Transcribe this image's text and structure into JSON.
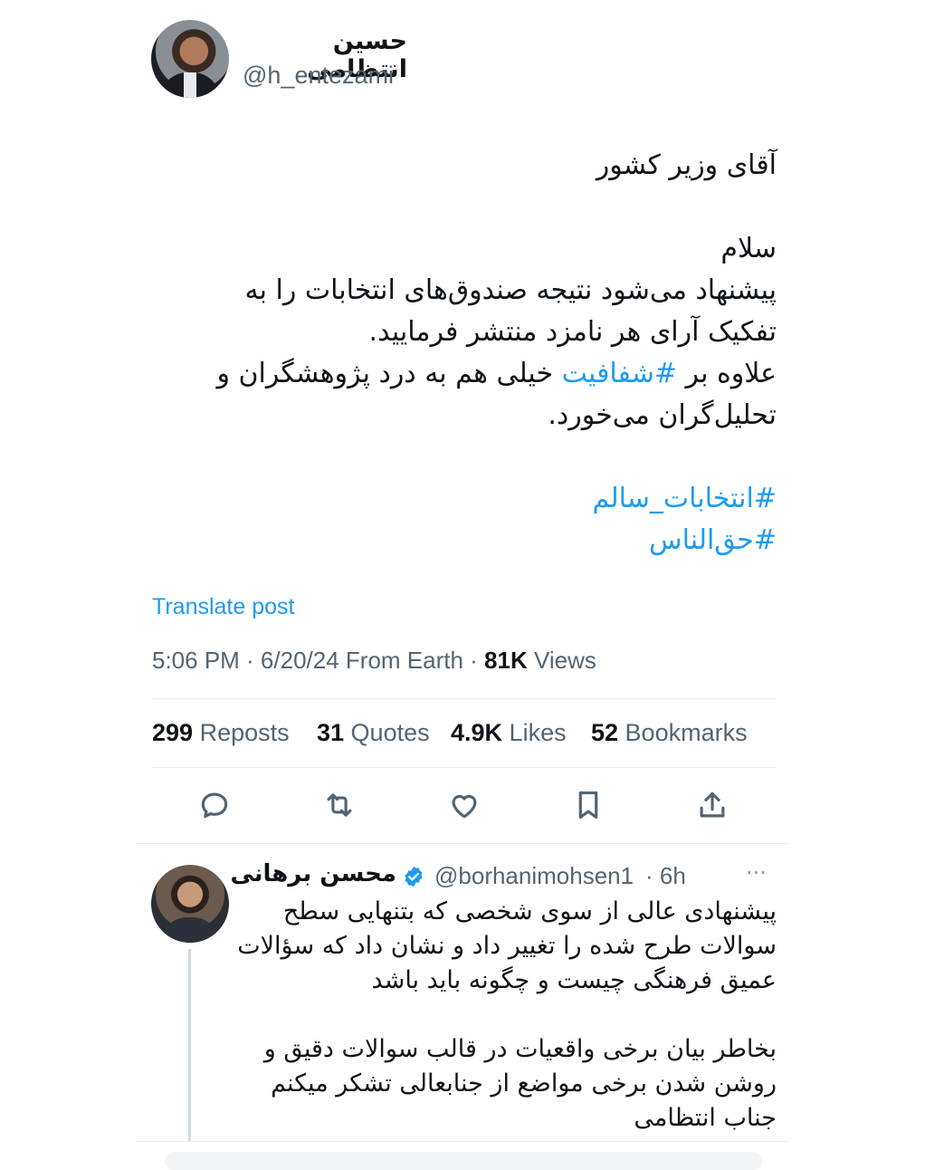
{
  "author": {
    "display_name": "حسین انتظامی",
    "handle": "@h_entezami"
  },
  "post": {
    "line_1": "آقای وزیر کشور",
    "line_2": "سلام",
    "line_3": "پیشنهاد می‌شود نتیجه صندوق‌های انتخابات را به",
    "line_4": "تفکیک آرای هر نامزد منتشر فرمایید.",
    "line_5_start": "علاوه بر ",
    "line_5_hashtag": "#شفافیت",
    "line_5_end": " خیلی هم به درد پژوهشگران و",
    "line_6": "تحلیل‌گران می‌خورد.",
    "hashtag_1": "#انتخابات_سالم",
    "hashtag_2": "#حق‌الناس"
  },
  "translate_label": "Translate post",
  "meta": {
    "time_date_source": "5:06 PM · 6/20/24 From Earth · ",
    "views_count": "81K",
    "views_label": " Views"
  },
  "stats": {
    "reposts_count": "299",
    "reposts_label": " Reposts",
    "quotes_count": "31",
    "quotes_label": " Quotes",
    "likes_count": "4.9K",
    "likes_label": " Likes",
    "bookmarks_count": "52",
    "bookmarks_label": " Bookmarks"
  },
  "actions": [
    "reply-icon",
    "repost-icon",
    "like-icon",
    "bookmark-icon",
    "share-icon"
  ],
  "reply": {
    "display_name": "محسن برهانی",
    "handle": "@borhanimohsen1",
    "time": " · 6h",
    "more": "···",
    "line_1": "پیشنهادی عالی از سوی شخصی که بتنهایی سطح",
    "line_2": "سوالات طرح شده را تغییر داد و نشان داد که سؤالات",
    "line_3": "عمیق فرهنگی چیست و چگونه باید باشد",
    "line_4": "بخاطر بیان برخی واقعیات در قالب سوالات دقیق و",
    "line_5": "روشن شدن برخی مواضع از جنابعالی تشکر میکنم",
    "line_6": "جناب انتظامی"
  },
  "colors": {
    "link": "#1d9bf0",
    "muted": "#536471",
    "text": "#0f1419",
    "verified": "#1d9bf0"
  }
}
